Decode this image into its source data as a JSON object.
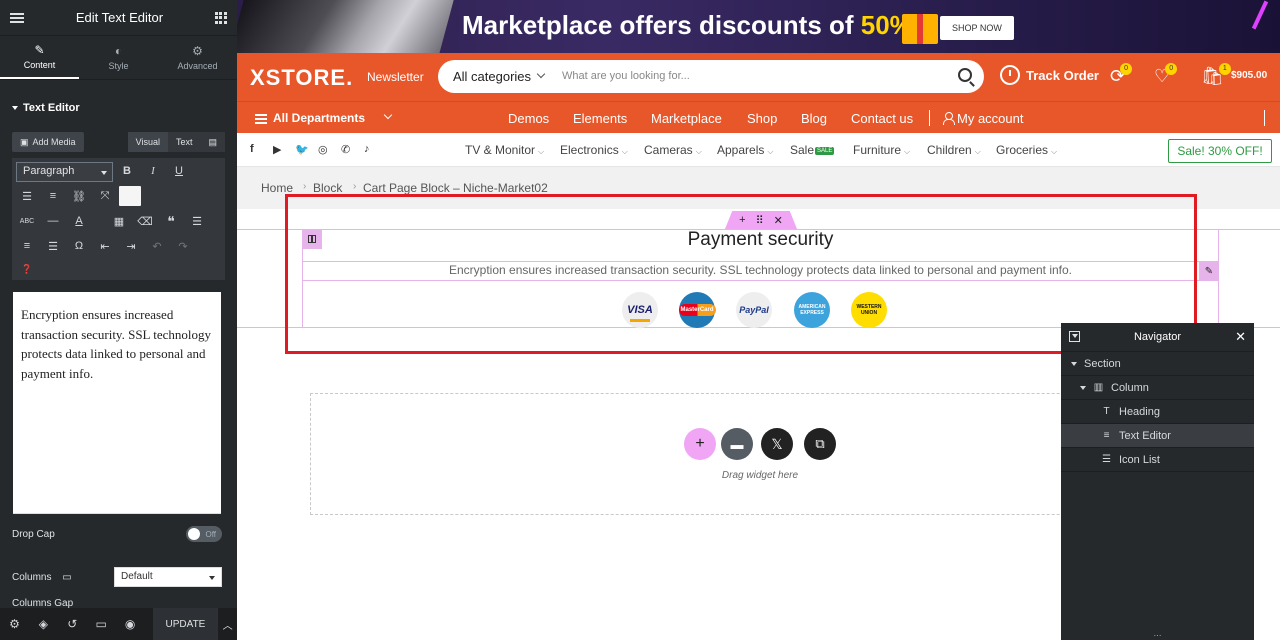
{
  "panel": {
    "title": "Edit Text Editor",
    "tabs": [
      {
        "label": "Content",
        "icon": "pencil-icon"
      },
      {
        "label": "Style",
        "icon": "contrast-icon"
      },
      {
        "label": "Advanced",
        "icon": "gear-icon"
      }
    ],
    "section_title": "Text Editor",
    "add_media": "Add Media",
    "visual_tab": "Visual",
    "text_tab": "Text",
    "format_select": "Paragraph",
    "content": "Encryption ensures increased transaction security. SSL technology protects data linked to personal and payment info.",
    "drop_cap_label": "Drop Cap",
    "drop_cap_value": "Off",
    "columns_label": "Columns",
    "columns_value": "Default",
    "columns_gap_label": "Columns Gap",
    "update_label": "UPDATE"
  },
  "banner": {
    "text": "Marketplace offers discounts of ",
    "percent": "50%",
    "cta": "SHOP NOW"
  },
  "header": {
    "logo": "XSTORE.",
    "newsletter": "Newsletter",
    "category": "All categories",
    "search_placeholder": "What are you looking for...",
    "track_order": "Track Order",
    "compare_count": "0",
    "wishlist_count": "0",
    "cart_count": "1",
    "cart_total": "$905.00"
  },
  "nav": {
    "departments": "All Departments",
    "links": [
      "Demos",
      "Elements",
      "Marketplace",
      "Shop",
      "Blog",
      "Contact us"
    ],
    "account": "My account"
  },
  "subnav": {
    "links": [
      "TV & Monitor",
      "Electronics",
      "Cameras",
      "Apparels",
      "Sale",
      "Furniture",
      "Children",
      "Groceries"
    ],
    "sale_tag": "SALE",
    "sale_button": "Sale! 30% OFF!"
  },
  "breadcrumb": [
    "Home",
    "Block",
    "Cart Page Block – Niche-Market02"
  ],
  "section": {
    "heading": "Payment security",
    "text": "Encryption ensures increased transaction security. SSL technology protects data linked to personal and payment info.",
    "payments": {
      "visa": "VISA",
      "mastercard": "MasterCard",
      "paypal": "PayPal",
      "amex": "AMERICAN EXPRESS",
      "wu": "WESTERN UNION"
    }
  },
  "dropzone": {
    "text": "Drag widget here"
  },
  "navigator": {
    "title": "Navigator",
    "items": [
      "Section",
      "Column",
      "Heading",
      "Text Editor",
      "Icon List"
    ]
  },
  "colors": {
    "brand_orange": "#e8572a",
    "elementor_pink": "#f0a6f5",
    "highlight_red": "#e01b24",
    "panel_dark": "#26292c",
    "sale_green": "#2e9a43"
  }
}
